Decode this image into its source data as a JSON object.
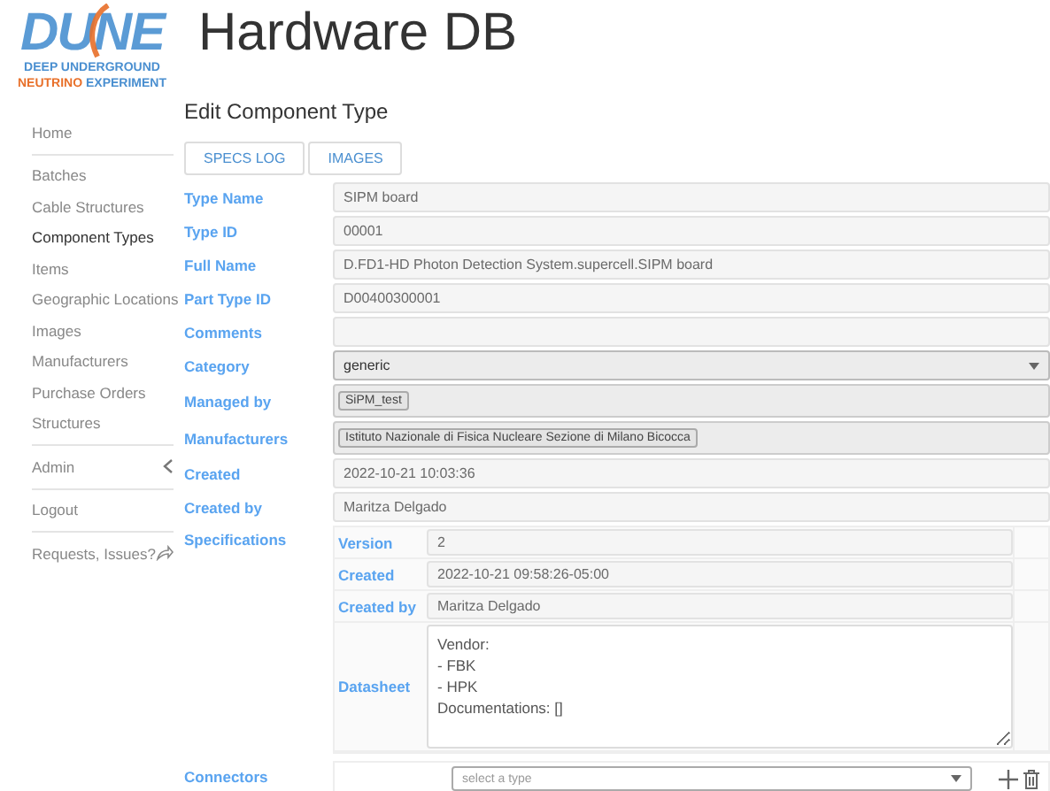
{
  "header": {
    "logo_word": "DUNE",
    "logo_line_1": "DEEP UNDERGROUND",
    "logo_line_2a": "NEUTRINO",
    "logo_line_2b": "EXPERIMENT",
    "title": "Hardware DB"
  },
  "sidebar": {
    "groups": [
      [
        {
          "label": "Home",
          "kind": "link",
          "selected": false
        }
      ],
      [
        {
          "label": "Batches",
          "kind": "link",
          "selected": false
        },
        {
          "label": "Cable Structures",
          "kind": "link",
          "selected": false
        },
        {
          "label": "Component Types",
          "kind": "link",
          "selected": true
        },
        {
          "label": "Items",
          "kind": "link",
          "selected": false
        },
        {
          "label": "Geographic Locations",
          "kind": "link",
          "selected": false
        },
        {
          "label": "Images",
          "kind": "link",
          "selected": false
        },
        {
          "label": "Manufacturers",
          "kind": "link",
          "selected": false
        },
        {
          "label": "Purchase Orders",
          "kind": "link",
          "selected": false
        },
        {
          "label": "Structures",
          "kind": "link",
          "selected": false
        }
      ],
      [
        {
          "label": "Admin",
          "kind": "menu",
          "selected": false
        }
      ],
      [
        {
          "label": "Logout",
          "kind": "link",
          "selected": false
        }
      ],
      [
        {
          "label": "Requests, Issues?",
          "kind": "external",
          "selected": false
        }
      ]
    ]
  },
  "page_title": "Edit Component Type",
  "tabs": [
    {
      "label": "SPECS LOG",
      "selected": false
    },
    {
      "label": "IMAGES",
      "selected": false
    }
  ],
  "fields": [
    {
      "label": "Type Name",
      "kind": "text",
      "value": "SIPM board"
    },
    {
      "label": "Type ID",
      "kind": "text",
      "value": "00001"
    },
    {
      "label": "Full Name",
      "kind": "text",
      "value": "D.FD1-HD Photon Detection System.supercell.SIPM board"
    },
    {
      "label": "Part Type ID",
      "kind": "text",
      "value": "D00400300001"
    },
    {
      "label": "Comments",
      "kind": "text"
    },
    {
      "label": "Category",
      "kind": "select",
      "value": "generic"
    },
    {
      "label": "Managed by",
      "kind": "tags",
      "tags": [
        "SiPM_test"
      ]
    },
    {
      "label": "Manufacturers",
      "kind": "tags",
      "tags": [
        "Istituto Nazionale di Fisica Nucleare Sezione di Milano Bicocca"
      ]
    },
    {
      "label": "Created",
      "kind": "text",
      "value": "2022-10-21 10:03:36"
    },
    {
      "label": "Created by",
      "kind": "text",
      "value": "Maritza Delgado"
    }
  ],
  "specifications": {
    "label": "Specifications",
    "rows": [
      {
        "label": "Version",
        "kind": "text",
        "value": "2"
      },
      {
        "label": "Created",
        "kind": "text",
        "value": "2022-10-21 09:58:26-05:00"
      },
      {
        "label": "Created by",
        "kind": "text",
        "value": "Maritza Delgado"
      },
      {
        "label": "Datasheet",
        "kind": "textarea",
        "value": "Vendor:\n- FBK\n- HPK\nDocumentations: []"
      }
    ]
  },
  "connectors": {
    "label": "Connectors",
    "type_placeholder": "select a type"
  }
}
